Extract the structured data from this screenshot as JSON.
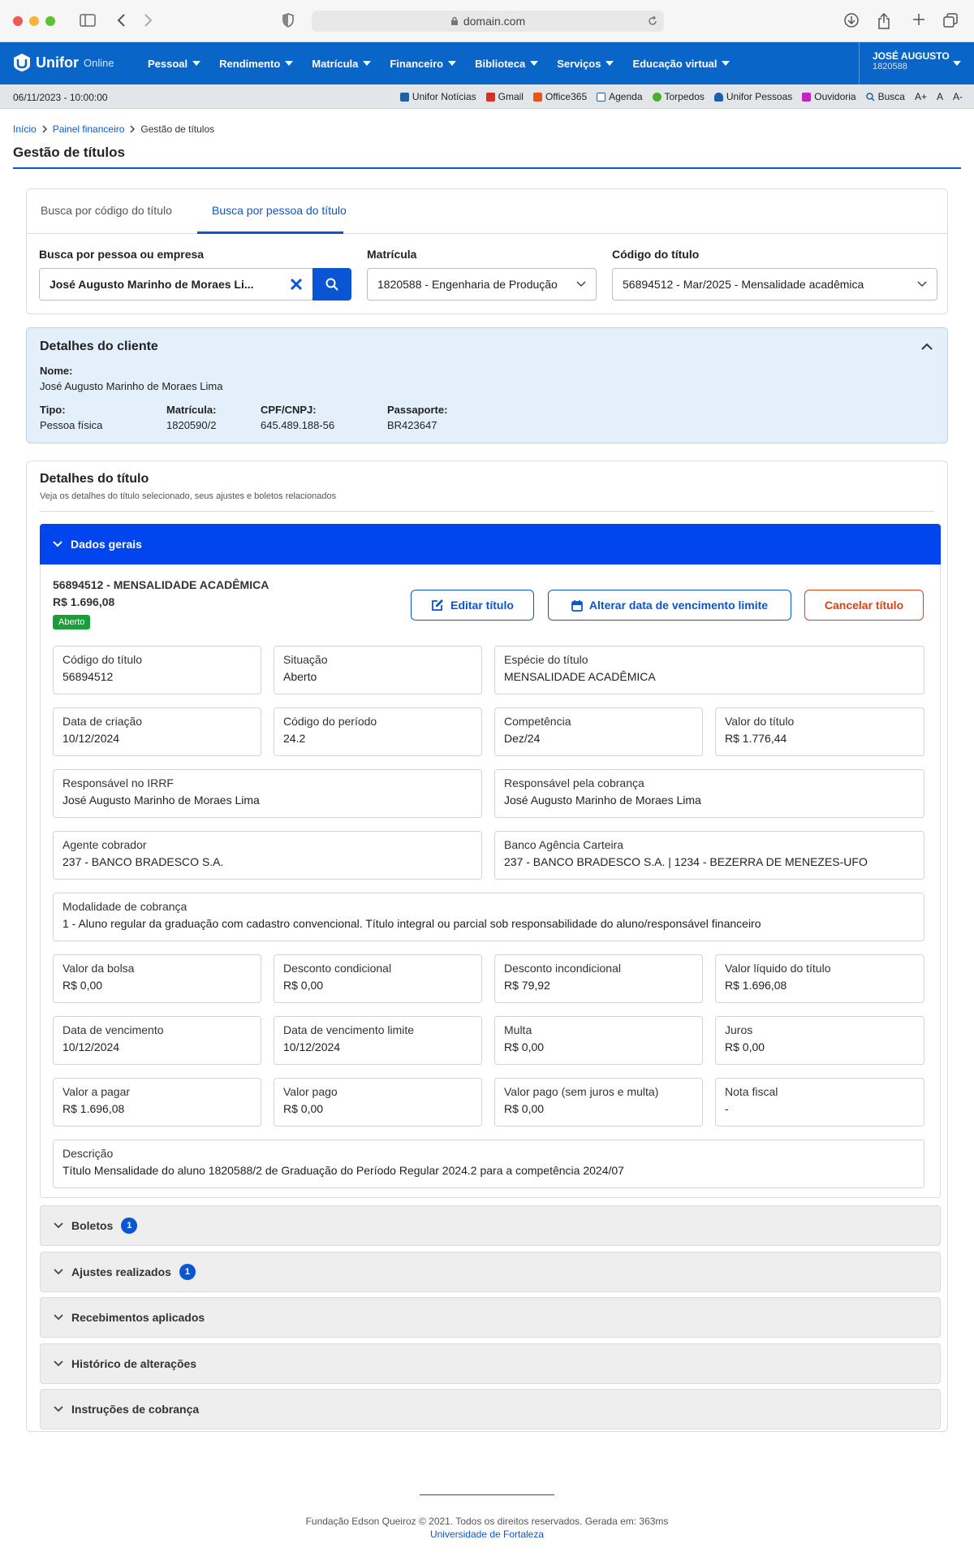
{
  "browser": {
    "url": "domain.com"
  },
  "nav": {
    "logo": "Unifor",
    "logo_sub": "Online",
    "menu": [
      "Pessoal",
      "Rendimento",
      "Matrícula",
      "Financeiro",
      "Biblioteca",
      "Serviços",
      "Educação virtual"
    ],
    "user_name": "JOSÉ AUGUSTO",
    "user_id": "1820588"
  },
  "util": {
    "datetime": "06/11/2023 - 10:00:00",
    "links": [
      "Unifor Notícias",
      "Gmail",
      "Office365",
      "Agenda",
      "Torpedos",
      "Unifor Pessoas",
      "Ouvidoria",
      "Busca",
      "A+",
      "A",
      "A-"
    ]
  },
  "breadcrumb": {
    "home": "Início",
    "parent": "Painel financeiro",
    "current": "Gestão de títulos"
  },
  "page_title": "Gestão de títulos",
  "search": {
    "tab1": "Busca por código do título",
    "tab2": "Busca por pessoa do título",
    "person_label": "Busca por pessoa ou empresa",
    "person_value": "José Augusto Marinho de Moraes Li...",
    "matricula_label": "Matrícula",
    "matricula_value": "1820588 - Engenharia de Produção",
    "codigo_label": "Código do título",
    "codigo_value": "56894512 - Mar/2025 - Mensalidade acadêmica"
  },
  "client": {
    "title": "Detalhes do cliente",
    "nome_label": "Nome:",
    "nome": "José Augusto Marinho de Moraes Lima",
    "tipo_label": "Tipo:",
    "tipo": "Pessoa física",
    "matricula_label": "Matrícula:",
    "matricula": "1820590/2",
    "cpf_label": "CPF/CNPJ:",
    "cpf": "645.489.188-56",
    "passaporte_label": "Passaporte:",
    "passaporte": "BR423647"
  },
  "titulo": {
    "title": "Detalhes do título",
    "subtitle": "Veja os detalhes do título selecionado, seus ajustes e boletos relacionados",
    "section": "Dados gerais",
    "heading": "56894512 - MENSALIDADE ACADÊMICA",
    "amount": "R$ 1.696,08",
    "status": "Aberto",
    "btn_edit": "Editar título",
    "btn_date": "Alterar data de vencimento limite",
    "btn_cancel": "Cancelar título",
    "fields": [
      {
        "label": "Código do título",
        "value": "56894512"
      },
      {
        "label": "Situação",
        "value": "Aberto"
      },
      {
        "label": "Espécie do título",
        "value": "MENSALIDADE ACADÊMICA"
      },
      {
        "label": "Data de criação",
        "value": "10/12/2024"
      },
      {
        "label": "Código do período",
        "value": "24.2"
      },
      {
        "label": "Competência",
        "value": "Dez/24"
      },
      {
        "label": "Valor do título",
        "value": "R$ 1.776,44"
      },
      {
        "label": "Responsável no IRRF",
        "value": "José Augusto Marinho de Moraes Lima"
      },
      {
        "label": "Responsável pela cobrança",
        "value": "José Augusto Marinho de Moraes Lima"
      },
      {
        "label": "Agente cobrador",
        "value": "237 - BANCO BRADESCO S.A."
      },
      {
        "label": "Banco Agência Carteira",
        "value": "237 - BANCO BRADESCO S.A. | 1234 - BEZERRA DE MENEZES-UFO"
      },
      {
        "label": "Modalidade de cobrança",
        "value": "1 - Aluno regular da graduação com cadastro convencional. Título integral ou parcial sob responsabilidade do aluno/responsável financeiro"
      },
      {
        "label": "Valor da bolsa",
        "value": "R$ 0,00"
      },
      {
        "label": "Desconto condicional",
        "value": "R$ 0,00"
      },
      {
        "label": "Desconto incondicional",
        "value": "R$ 79,92"
      },
      {
        "label": "Valor líquido do título",
        "value": "R$ 1.696,08"
      },
      {
        "label": "Data de vencimento",
        "value": "10/12/2024"
      },
      {
        "label": "Data de vencimento limite",
        "value": "10/12/2024"
      },
      {
        "label": "Multa",
        "value": "R$ 0,00"
      },
      {
        "label": "Juros",
        "value": "R$ 0,00"
      },
      {
        "label": "Valor a pagar",
        "value": "R$ 1.696,08"
      },
      {
        "label": "Valor pago",
        "value": "R$ 0,00"
      },
      {
        "label": "Valor pago (sem juros e multa)",
        "value": "R$ 0,00"
      },
      {
        "label": "Nota fiscal",
        "value": "-"
      },
      {
        "label": "Descrição",
        "value": "Título Mensalidade do aluno 1820588/2 de Graduação do Período Regular 2024.2 para a competência 2024/07"
      }
    ],
    "sections": [
      {
        "label": "Boletos",
        "count": "1"
      },
      {
        "label": "Ajustes realizados",
        "count": "1"
      },
      {
        "label": "Recebimentos aplicados"
      },
      {
        "label": "Histórico de alterações"
      },
      {
        "label": "Instruções de cobrança"
      }
    ]
  },
  "footer": {
    "copyright": "Fundação Edson Queiroz © 2021. Todos os direitos reservados. Gerada em: 363ms",
    "link": "Universidade de Fortaleza"
  }
}
